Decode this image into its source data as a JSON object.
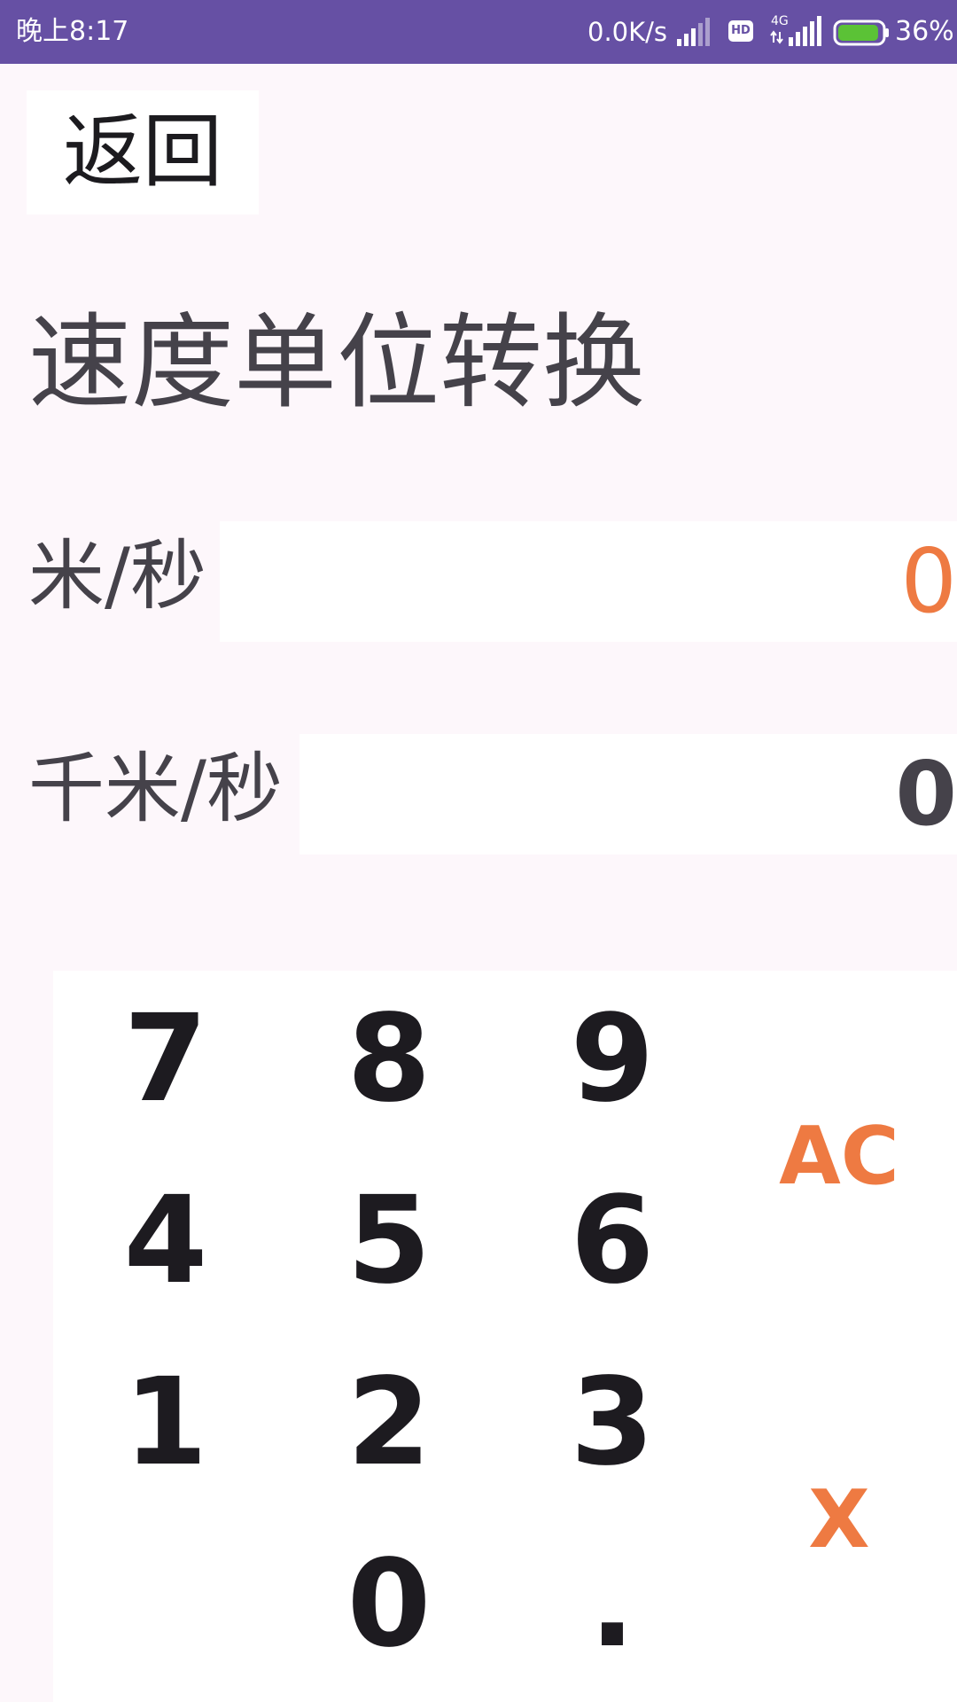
{
  "status_bar": {
    "time": "晚上8:17",
    "net_speed": "0.0K/s",
    "hd_badge": "HD",
    "network_type": "4G",
    "battery_percent": "36%",
    "battery_level": 0.36,
    "colors": {
      "background": "#6650a4",
      "battery_fill": "#5bc236"
    }
  },
  "toolbar": {
    "back_label": "返回"
  },
  "page": {
    "title": "速度单位转换"
  },
  "units": [
    {
      "label": "米/秒",
      "value": "0"
    },
    {
      "label": "千米/秒",
      "value": "0"
    }
  ],
  "keypad": {
    "row1": [
      "7",
      "8",
      "9"
    ],
    "row2": [
      "4",
      "5",
      "6"
    ],
    "row3": [
      "1",
      "2",
      "3"
    ],
    "row4": [
      "0",
      "."
    ],
    "clear_label": "AC",
    "delete_label": "X"
  },
  "colors": {
    "accent": "#ee7a42",
    "text": "#45424a",
    "background": "#fdf7fb"
  }
}
